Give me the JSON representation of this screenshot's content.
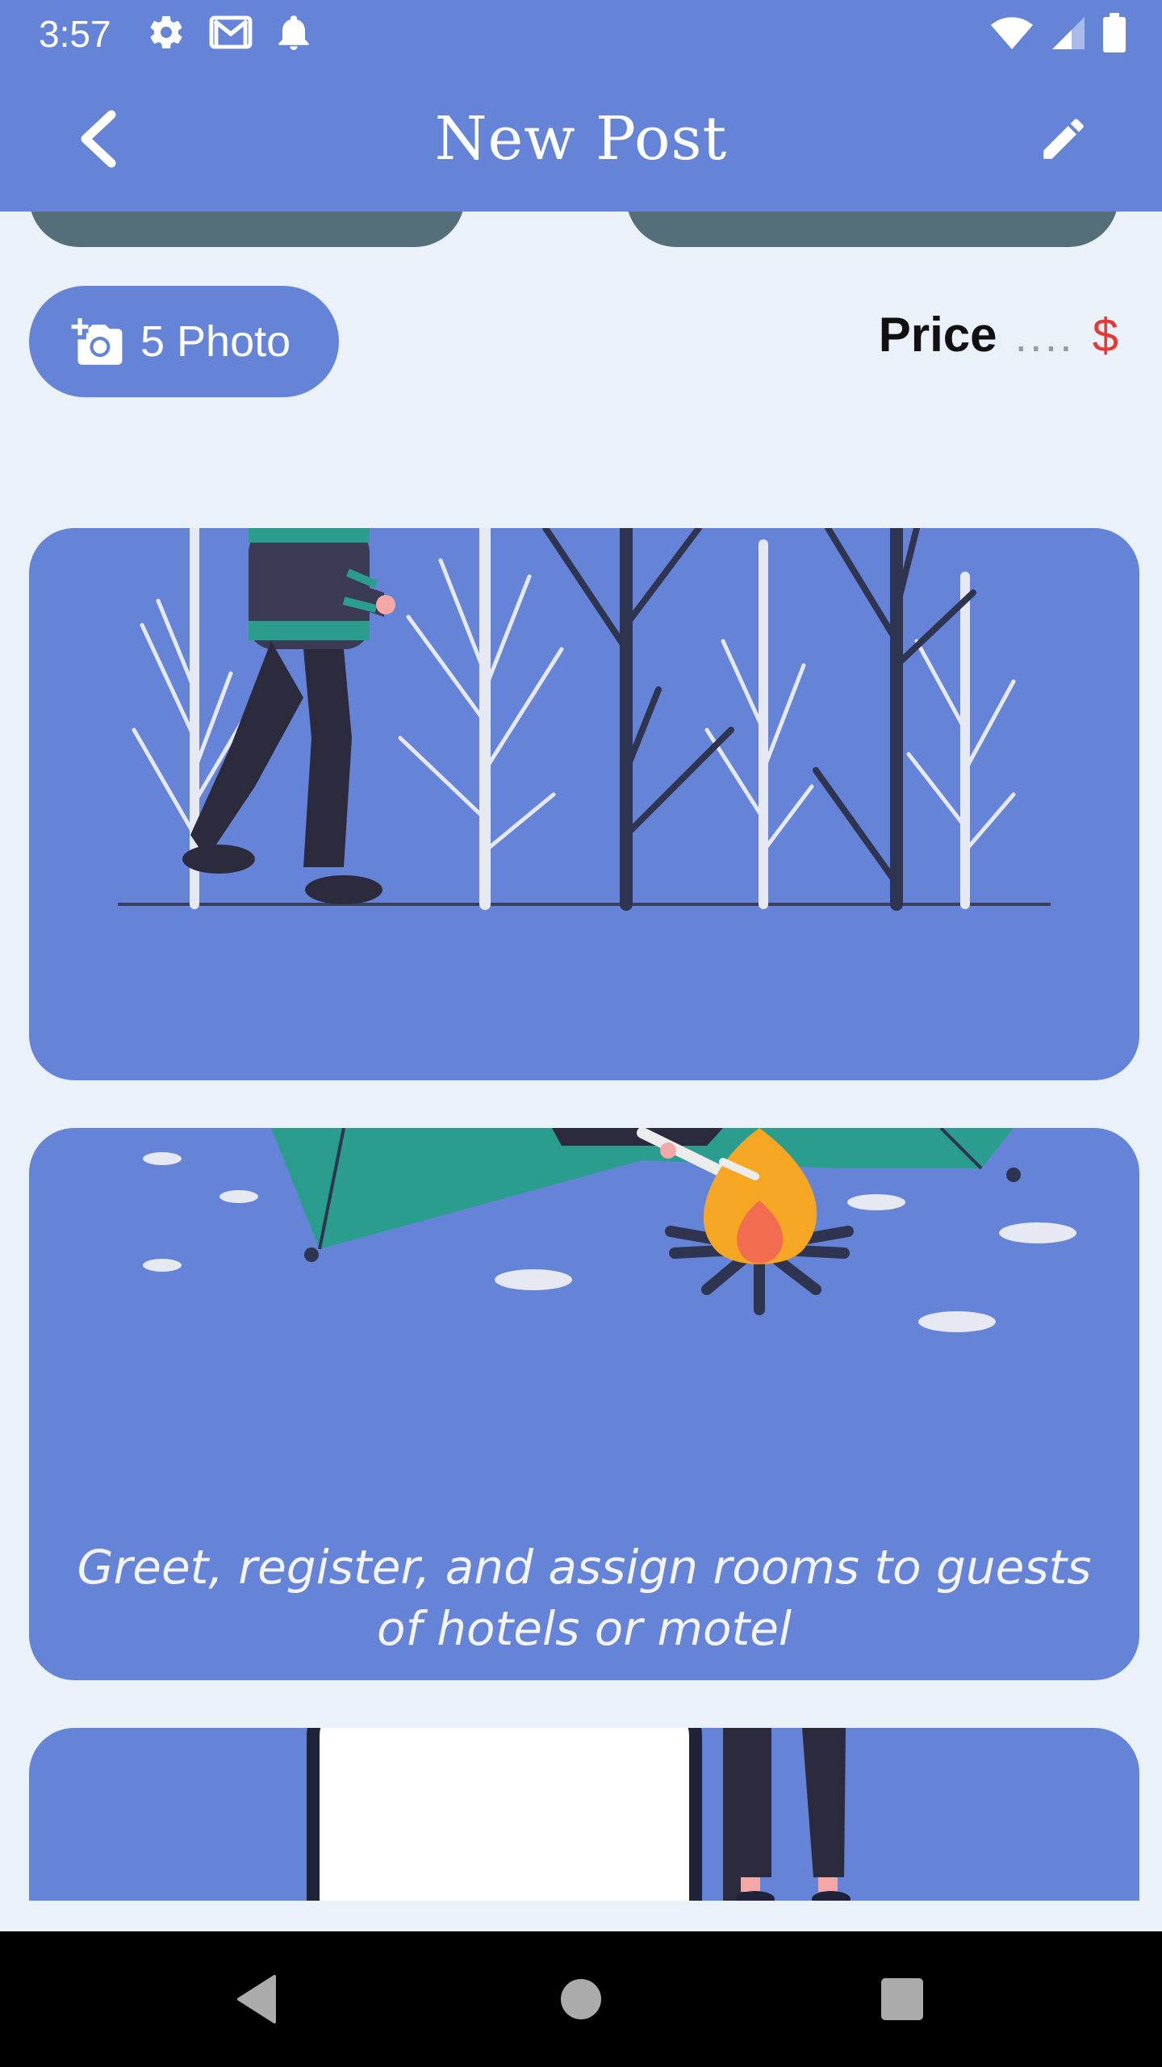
{
  "status_bar": {
    "time": "3:57",
    "left_icons": [
      "settings-icon",
      "gmail-icon",
      "notification-bell-icon"
    ],
    "right_icons": [
      "wifi-icon",
      "signal-icon",
      "battery-icon"
    ]
  },
  "app_bar": {
    "title": "New Post",
    "back_icon": "chevron-left-icon",
    "edit_icon": "pencil-icon"
  },
  "photo_button": {
    "label": "5 Photo",
    "icon": "add-camera-icon"
  },
  "price": {
    "label": "Price",
    "placeholder": "....",
    "currency": "$"
  },
  "cards": [
    {
      "illustration": "walking-in-winter-forest",
      "caption": ""
    },
    {
      "illustration": "campfire-by-tent",
      "caption": "Greet, register, and assign rooms to guests of hotels or motel"
    },
    {
      "illustration": "person-by-door",
      "caption": ""
    }
  ],
  "colors": {
    "primary": "#6584d8",
    "background": "#ebf1f8",
    "pill": "#546e7a",
    "currency": "#e53935"
  },
  "nav_bar": {
    "buttons": [
      "back-triangle-icon",
      "home-circle-icon",
      "recents-square-icon"
    ]
  }
}
